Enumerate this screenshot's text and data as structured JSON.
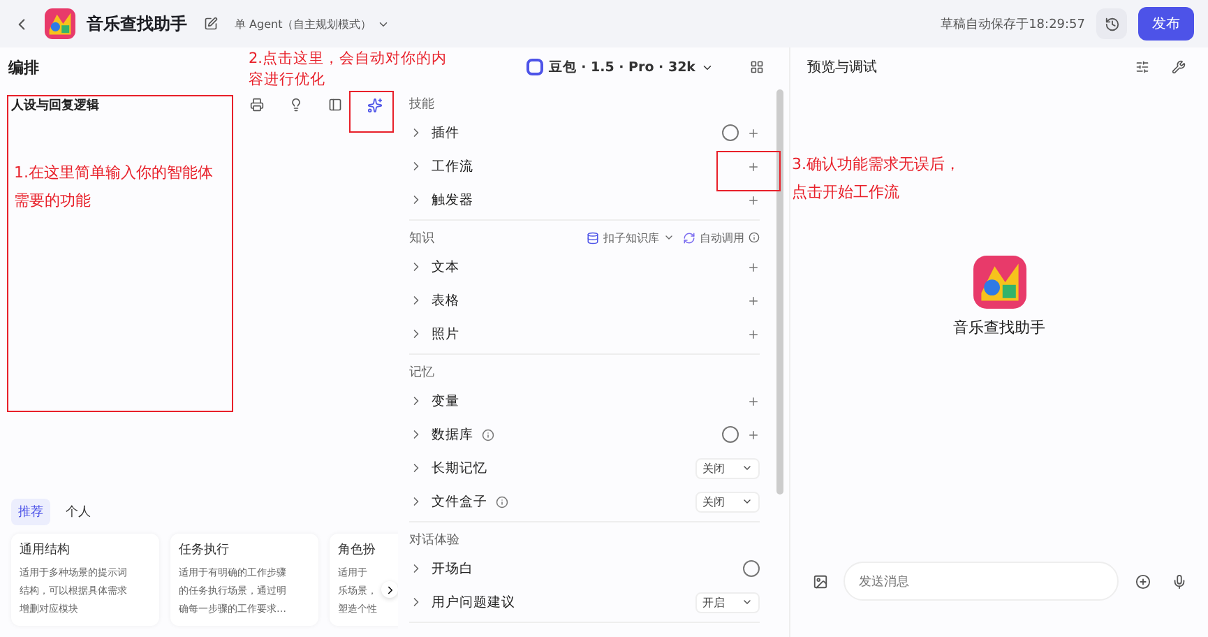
{
  "header": {
    "title": "音乐查找助手",
    "mode": "单 Agent（自主规划模式）",
    "save_status": "草稿自动保存于18:29:57",
    "publish": "发布"
  },
  "editor": {
    "title": "编排",
    "model": "豆包 · 1.5 · Pro · 32k"
  },
  "prompt": {
    "title": "人设与回复逻辑"
  },
  "templates": {
    "tabs": [
      {
        "label": "推荐",
        "selected": true
      },
      {
        "label": "个人",
        "selected": false
      }
    ],
    "cards": [
      {
        "title": "通用结构",
        "lines": [
          "适用于多种场景的提示词",
          "结构，可以根据具体需求",
          "增删对应模块"
        ]
      },
      {
        "title": "任务执行",
        "lines": [
          "适用于有明确的工作步骤",
          "的任务执行场景，通过明",
          "确每一步骤的工作要求…"
        ]
      },
      {
        "title": "角色扮",
        "lines": [
          "适用于",
          "乐场景，",
          "塑造个性"
        ]
      }
    ]
  },
  "sections": [
    {
      "title": "技能",
      "items": [
        {
          "label": "插件",
          "info": false,
          "auto": true,
          "add": true
        },
        {
          "label": "工作流",
          "info": false,
          "auto": false,
          "add": true
        },
        {
          "label": "触发器",
          "info": false,
          "auto": false,
          "add": true
        }
      ]
    },
    {
      "title": "知识",
      "knowledge_base": "扣子知识库",
      "auto_call": "自动调用",
      "items": [
        {
          "label": "文本",
          "info": false,
          "auto": false,
          "add": true
        },
        {
          "label": "表格",
          "info": false,
          "auto": false,
          "add": true
        },
        {
          "label": "照片",
          "info": false,
          "auto": false,
          "add": true
        }
      ]
    },
    {
      "title": "记忆",
      "items": [
        {
          "label": "变量",
          "info": false,
          "auto": false,
          "add": true
        },
        {
          "label": "数据库",
          "info": true,
          "auto": true,
          "add": true
        },
        {
          "label": "长期记忆",
          "info": false,
          "auto": false,
          "add": false,
          "select": "关闭"
        },
        {
          "label": "文件盒子",
          "info": true,
          "auto": false,
          "add": false,
          "select": "关闭"
        }
      ]
    },
    {
      "title": "对话体验",
      "items": [
        {
          "label": "开场白",
          "info": false,
          "auto": true,
          "add": false
        },
        {
          "label": "用户问题建议",
          "info": false,
          "auto": false,
          "add": false,
          "select": "开启"
        }
      ]
    }
  ],
  "preview": {
    "title": "预览与调试",
    "bot_name": "音乐查找助手",
    "input_placeholder": "发送消息"
  },
  "annotations": [
    {
      "text": "1.在这里简单输入你的智能体需要的功能"
    },
    {
      "text": "2.点击这里，会自动对你的内容进行优化"
    },
    {
      "text": "3.确认功能需求无误后，点击开始工作流"
    }
  ]
}
